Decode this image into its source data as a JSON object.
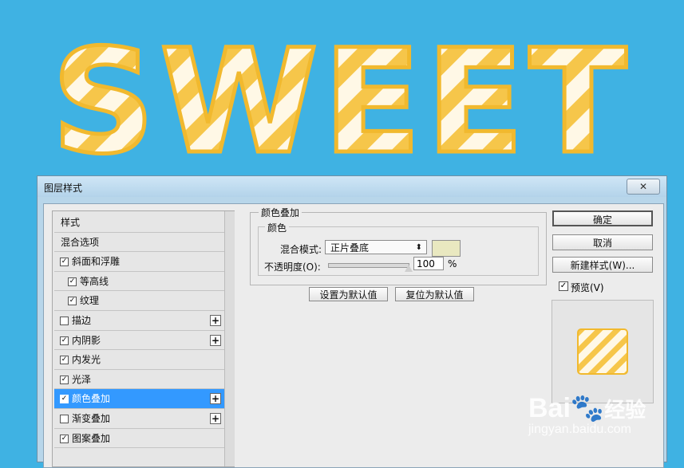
{
  "artwork": {
    "title_text": "SWEET",
    "bg_color": "#3fb2e3",
    "letter_fill": "#fff8e6",
    "stripe_color": "#f6c64a"
  },
  "dialog": {
    "title": "图层样式",
    "close_icon": "close-x"
  },
  "left_list": [
    {
      "label": "样式",
      "checkbox": false,
      "checked": false,
      "plus": false,
      "selected": false,
      "sub": false
    },
    {
      "label": "混合选项",
      "checkbox": false,
      "checked": false,
      "plus": false,
      "selected": false,
      "sub": false
    },
    {
      "label": "斜面和浮雕",
      "checkbox": true,
      "checked": true,
      "plus": false,
      "selected": false,
      "sub": false
    },
    {
      "label": "等高线",
      "checkbox": true,
      "checked": true,
      "plus": false,
      "selected": false,
      "sub": true
    },
    {
      "label": "纹理",
      "checkbox": true,
      "checked": true,
      "plus": false,
      "selected": false,
      "sub": true
    },
    {
      "label": "描边",
      "checkbox": true,
      "checked": false,
      "plus": true,
      "selected": false,
      "sub": false
    },
    {
      "label": "内阴影",
      "checkbox": true,
      "checked": true,
      "plus": true,
      "selected": false,
      "sub": false
    },
    {
      "label": "内发光",
      "checkbox": true,
      "checked": true,
      "plus": false,
      "selected": false,
      "sub": false
    },
    {
      "label": "光泽",
      "checkbox": true,
      "checked": true,
      "plus": false,
      "selected": false,
      "sub": false
    },
    {
      "label": "颜色叠加",
      "checkbox": true,
      "checked": true,
      "plus": true,
      "selected": true,
      "sub": false
    },
    {
      "label": "渐变叠加",
      "checkbox": true,
      "checked": false,
      "plus": true,
      "selected": false,
      "sub": false
    },
    {
      "label": "图案叠加",
      "checkbox": true,
      "checked": true,
      "plus": false,
      "selected": false,
      "sub": false
    }
  ],
  "settings": {
    "group_title": "颜色叠加",
    "sub_group_title": "颜色",
    "blend_mode_label": "混合模式:",
    "blend_mode_value": "正片叠底",
    "overlay_color": "#e9e8c0",
    "opacity_label": "不透明度(O):",
    "opacity_value": "100",
    "opacity_unit": "%",
    "opacity_fraction": 1.0,
    "set_default_button": "设置为默认值",
    "reset_default_button": "复位为默认值"
  },
  "right": {
    "ok_button": "确定",
    "cancel_button": "取消",
    "new_style_button": "新建样式(W)...",
    "preview_label": "预览(V)",
    "preview_checked": true
  },
  "watermark": {
    "brand": "Bai",
    "brand_cn": "经验",
    "url": "jingyan.baidu.com"
  }
}
